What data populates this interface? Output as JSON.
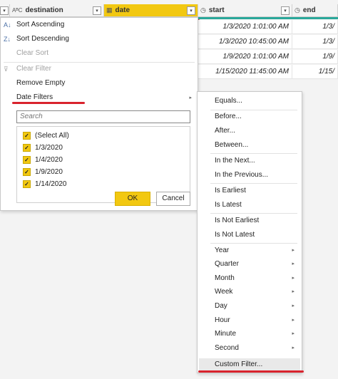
{
  "columns": [
    {
      "name": "destination",
      "type_icon": "ABC"
    },
    {
      "name": "date",
      "type_icon": "calendar-icon"
    },
    {
      "name": "start",
      "type_icon": "datetime-icon"
    },
    {
      "name": "end",
      "type_icon": "datetime-icon"
    }
  ],
  "rows": [
    {
      "start": "1/3/2020 1:01:00 AM",
      "end": "1/3/"
    },
    {
      "start": "1/3/2020 10:45:00 AM",
      "end": "1/3/"
    },
    {
      "start": "1/9/2020 1:01:00 AM",
      "end": "1/9/"
    },
    {
      "start": "1/15/2020 11:45:00 AM",
      "end": "1/15/"
    }
  ],
  "menu": {
    "sort_ascending": "Sort Ascending",
    "sort_descending": "Sort Descending",
    "clear_sort": "Clear Sort",
    "clear_filter": "Clear Filter",
    "remove_empty": "Remove Empty",
    "date_filters": "Date Filters",
    "search_placeholder": "Search",
    "values": [
      "(Select All)",
      "1/3/2020",
      "1/4/2020",
      "1/9/2020",
      "1/14/2020"
    ],
    "ok": "OK",
    "cancel": "Cancel"
  },
  "submenu": {
    "equals": "Equals...",
    "before": "Before...",
    "after": "After...",
    "between": "Between...",
    "in_the_next": "In the Next...",
    "in_the_previous": "In the Previous...",
    "is_earliest": "Is Earliest",
    "is_latest": "Is Latest",
    "is_not_earliest": "Is Not Earliest",
    "is_not_latest": "Is Not Latest",
    "year": "Year",
    "quarter": "Quarter",
    "month": "Month",
    "week": "Week",
    "day": "Day",
    "hour": "Hour",
    "minute": "Minute",
    "second": "Second",
    "custom_filter": "Custom Filter..."
  },
  "colors": {
    "accent": "#f2c811",
    "highlight": "#d9232d",
    "teal": "#2aa89a"
  }
}
